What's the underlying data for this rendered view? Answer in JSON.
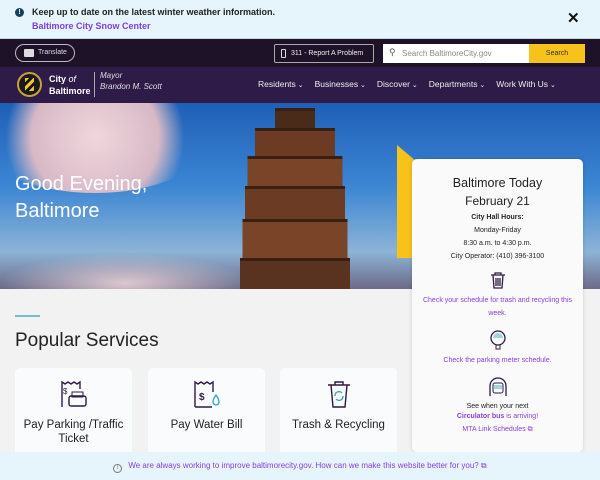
{
  "alert": {
    "message": "Keep up to date on the latest winter weather information.",
    "link": "Baltimore City Snow Center",
    "close": "✕"
  },
  "topbar": {
    "translate": "Translate",
    "report": "311 - Report A Problem",
    "search_placeholder": "Search BaltimoreCity.gov",
    "search_button": "Search"
  },
  "nav": {
    "logo_city": "City",
    "logo_of": "of",
    "logo_baltimore": "Baltimore",
    "mayor_title": "Mayor",
    "mayor_name": "Brandon M. Scott",
    "items": [
      "Residents",
      "Businesses",
      "Discover",
      "Departments",
      "Work With Us"
    ]
  },
  "hero": {
    "greeting_line1": "Good Evening,",
    "greeting_line2": "Baltimore"
  },
  "today": {
    "title": "Baltimore Today",
    "date": "February 21",
    "hours_label": "City Hall Hours:",
    "days": "Monday-Friday",
    "hours": "8:30 a.m. to 4:30 p.m.",
    "operator": "City Operator: (410) 396-3100",
    "trash_link": "Check your schedule for trash and recycling this week.",
    "meter_link": "Check the parking meter schedule.",
    "bus_text": "See when your next",
    "bus_link": "Circulator bus",
    "bus_suffix": " is arriving!",
    "mta_link": "MTA Link Schedules ⧉"
  },
  "services": {
    "title": "Popular Services",
    "items": [
      {
        "label": "Pay Parking /Traffic Ticket"
      },
      {
        "label": "Pay Water Bill"
      },
      {
        "label": "Trash & Recycling"
      }
    ]
  },
  "footer": {
    "message": "We are always working to improve baltimorecity.gov. How can we make this website better for you? ⧉"
  }
}
